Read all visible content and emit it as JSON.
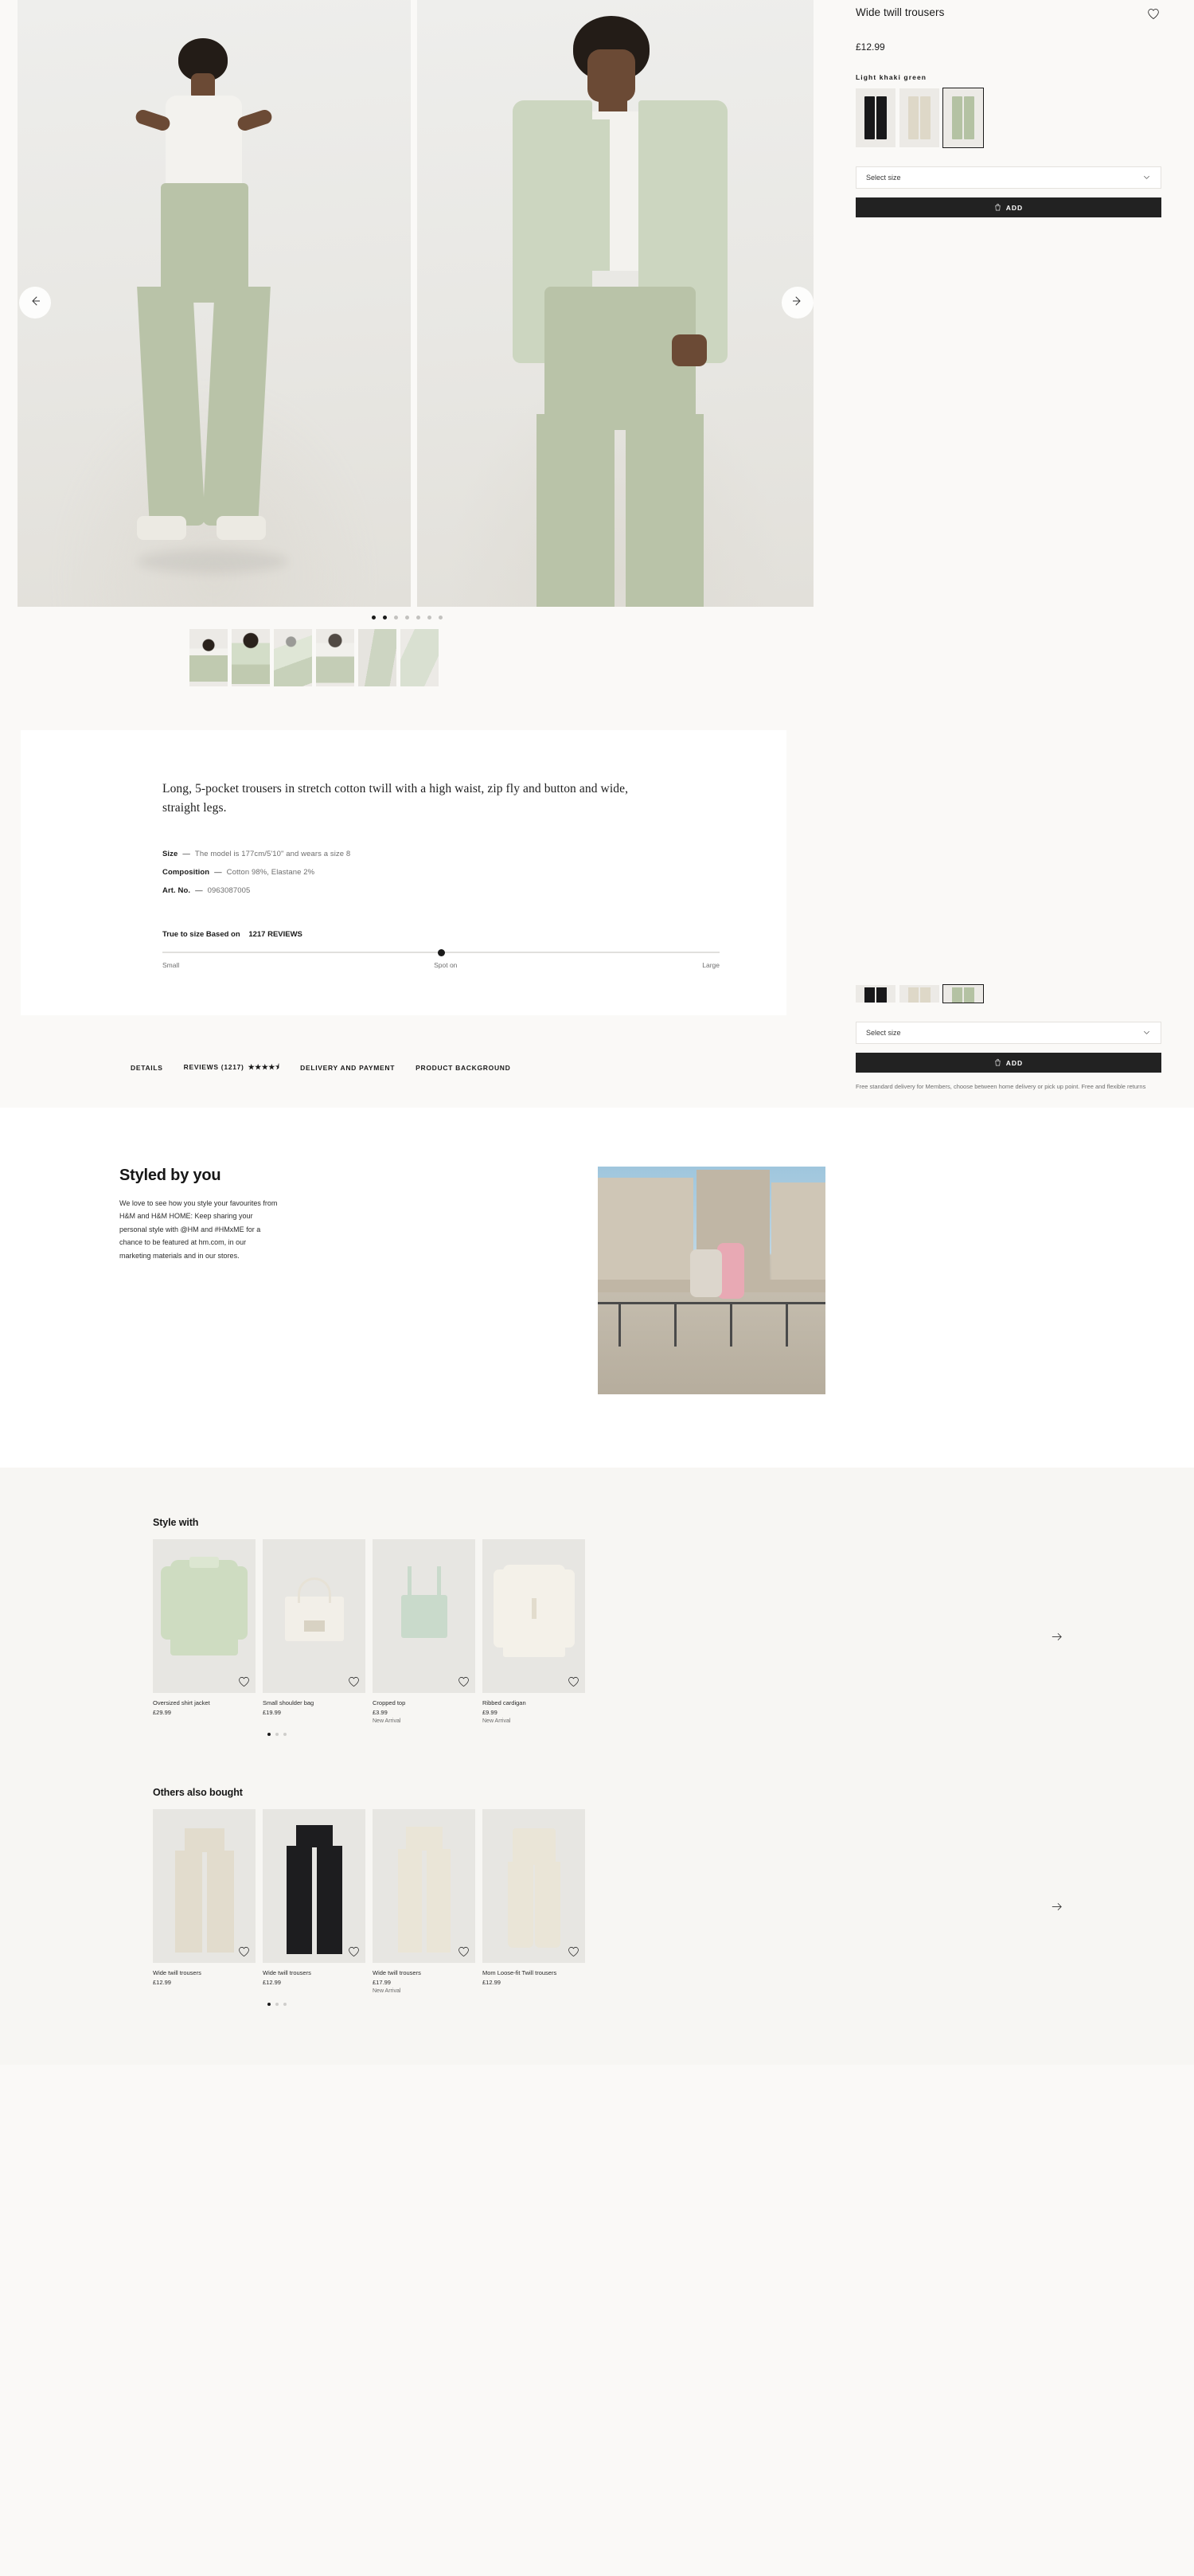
{
  "product": {
    "title": "Wide twill trousers",
    "price": "£12.99",
    "color_label": "Light khaki green",
    "select_size_label": "Select size",
    "add_label": "ADD",
    "delivery_note": "Free standard delivery for Members, choose between home delivery or pick up point. Free and flexible returns",
    "favourite_icon": "heart-icon",
    "add_icon": "shopping-bag-icon",
    "chevron_icon": "chevron-down-icon",
    "colors": [
      {
        "name": "Black",
        "hex": "#18181a",
        "selected": false
      },
      {
        "name": "Light beige",
        "hex": "#ded8c8",
        "selected": false
      },
      {
        "name": "Light khaki green",
        "hex": "#b4c2a3",
        "selected": true
      }
    ]
  },
  "gallery": {
    "prev_icon": "arrow-left-icon",
    "next_icon": "arrow-right-icon",
    "dots_total": 7,
    "dots_active": 2,
    "thumbnails_count": 6
  },
  "description": {
    "body": "Long, 5-pocket trousers in stretch cotton twill with a high waist, zip fly and button and wide, straight legs.",
    "specs": [
      {
        "key": "Size",
        "value": "The model is 177cm/5'10\" and wears a size 8"
      },
      {
        "key": "Composition",
        "value": "Cotton 98%, Elastane 2%"
      },
      {
        "key": "Art. No.",
        "value": "0963087005"
      }
    ],
    "fit": {
      "heading": "True to size Based on",
      "reviews": "1217 REVIEWS",
      "left_label": "Small",
      "mid_label": "Spot on",
      "right_label": "Large",
      "position_percent": 50
    }
  },
  "tabs": [
    {
      "label": "DETAILS",
      "stars": ""
    },
    {
      "label": "REVIEWS (1217)",
      "stars": "★★★★⯨"
    },
    {
      "label": "DELIVERY AND PAYMENT",
      "stars": ""
    },
    {
      "label": "PRODUCT BACKGROUND",
      "stars": ""
    }
  ],
  "styled_by_you": {
    "title": "Styled by you",
    "body": "We love to see how you style your favourites from H&M and H&M HOME: Keep sharing your personal style with @HM and #HMxME for a chance to be featured at hm.com, in our marketing materials and in our stores."
  },
  "carousels": [
    {
      "title": "Style with",
      "next_icon": "arrow-right-icon",
      "dots_total": 3,
      "dots_active": 1,
      "items": [
        {
          "name": "Oversized shirt jacket",
          "price": "£29.99",
          "badge": "",
          "fav_icon": "heart-icon",
          "kind": "jacket"
        },
        {
          "name": "Small shoulder bag",
          "price": "£19.99",
          "badge": "",
          "fav_icon": "heart-icon",
          "kind": "bag"
        },
        {
          "name": "Cropped top",
          "price": "£3.99",
          "badge": "New Arrival",
          "fav_icon": "heart-icon",
          "kind": "croptop"
        },
        {
          "name": "Ribbed cardigan",
          "price": "£9.99",
          "badge": "New Arrival",
          "fav_icon": "heart-icon",
          "kind": "cardigan"
        }
      ]
    },
    {
      "title": "Others also bought",
      "next_icon": "arrow-right-icon",
      "dots_total": 3,
      "dots_active": 1,
      "items": [
        {
          "name": "Wide twill trousers",
          "price": "£12.99",
          "badge": "",
          "fav_icon": "heart-icon",
          "kind": "trousers-beige"
        },
        {
          "name": "Wide twill trousers",
          "price": "£12.99",
          "badge": "",
          "fav_icon": "heart-icon",
          "kind": "trousers-black"
        },
        {
          "name": "Wide twill trousers",
          "price": "£17.99",
          "badge": "New Arrival",
          "fav_icon": "heart-icon",
          "kind": "trousers-cream"
        },
        {
          "name": "Mom Loose-fit Twill trousers",
          "price": "£12.99",
          "badge": "",
          "fav_icon": "heart-icon",
          "kind": "trousers-mom"
        }
      ]
    }
  ],
  "theme": {
    "page_bg": "#faf9f7",
    "panel_bg": "#ffffff",
    "carousel_bg": "#f7f6f3",
    "accent_dark": "#222222",
    "khaki": "#b4c2a3"
  }
}
